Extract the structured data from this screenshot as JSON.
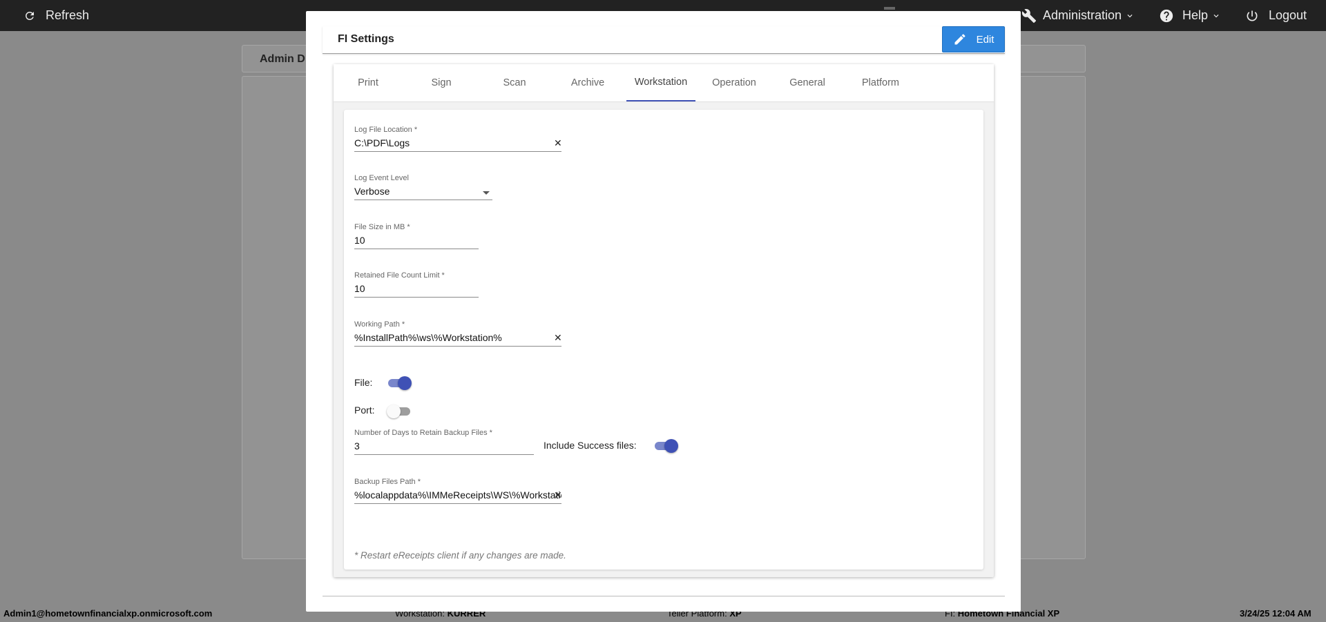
{
  "topbar": {
    "refresh_label": "Refresh",
    "administration_label": "Administration",
    "help_label": "Help",
    "logout_label": "Logout"
  },
  "background": {
    "header_text": "Admin D"
  },
  "statusbar": {
    "user": "Admin1@hometownfinancialxp.onmicrosoft.com",
    "workstation_label": "Workstation:",
    "workstation_value": "KURRER",
    "platform_label": "Teller Platform:",
    "platform_value": "XP",
    "fi_label": "FI:",
    "fi_value": "Hometown Financial XP",
    "datetime": "3/24/25 12:04 AM"
  },
  "modal": {
    "title": "FI Settings",
    "edit_label": "Edit",
    "tabs": [
      {
        "label": "Print"
      },
      {
        "label": "Sign"
      },
      {
        "label": "Scan"
      },
      {
        "label": "Archive"
      },
      {
        "label": "Workstation",
        "active": true
      },
      {
        "label": "Operation"
      },
      {
        "label": "General"
      },
      {
        "label": "Platform"
      }
    ],
    "form": {
      "log_file_location": {
        "label": "Log File Location *",
        "value": "C:\\PDF\\Logs"
      },
      "log_event_level": {
        "label": "Log Event Level",
        "value": "Verbose"
      },
      "file_size": {
        "label": "File Size in MB *",
        "value": "10"
      },
      "retained_count": {
        "label": "Retained File Count Limit *",
        "value": "10"
      },
      "working_path": {
        "label": "Working Path *",
        "value": "%InstallPath%\\ws\\%Workstation%"
      },
      "file_toggle": {
        "label": "File:",
        "on": true
      },
      "port_toggle": {
        "label": "Port:",
        "on": false
      },
      "retain_days": {
        "label": "Number of Days to Retain Backup Files *",
        "value": "3"
      },
      "include_success": {
        "label": "Include Success files:",
        "on": true
      },
      "backup_path": {
        "label": "Backup Files Path *",
        "value": "%localappdata%\\IMMeReceipts\\WS\\%Workstation%"
      }
    },
    "note": "* Restart eReceipts client if any changes are made."
  },
  "colors": {
    "accent": "#3f51b5",
    "button": "#2e86de",
    "topbar": "#222222",
    "overlay": "#8a8a8a"
  },
  "icons": {
    "refresh": "refresh-icon",
    "administration": "wrench-icon",
    "help": "help-circle-icon",
    "logout": "power-icon",
    "edit": "pencil-icon"
  }
}
